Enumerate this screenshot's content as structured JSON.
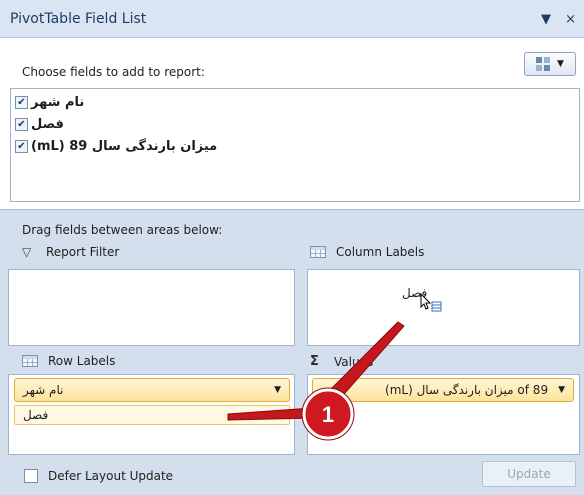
{
  "window": {
    "title": "PivotTable Field List",
    "controls": [
      "▼",
      "×"
    ]
  },
  "fields_section": {
    "instruction": "Choose fields to add to report:",
    "fields": [
      {
        "label": "نام شهر",
        "checked": true
      },
      {
        "label": "فصل",
        "checked": true
      },
      {
        "label": "میزان بارندگی سال 89 (mL)",
        "checked": true
      }
    ]
  },
  "areas_section": {
    "instruction": "Drag fields between areas below:",
    "report_filter": {
      "label": "Report Filter",
      "items": []
    },
    "column_labels": {
      "label": "Column Labels",
      "drag_text": "فصل"
    },
    "row_labels": {
      "label": "Row Labels",
      "items": [
        {
          "label": "نام شهر",
          "style": "dropdown"
        },
        {
          "label": "فصل",
          "style": "plain"
        }
      ]
    },
    "values": {
      "label": "Values",
      "items": [
        {
          "label": "of 89 میزان بارندگی سال (mL)",
          "style": "dropdown"
        }
      ]
    }
  },
  "footer": {
    "defer_label": "Defer Layout Update",
    "defer_checked": false,
    "update_label": "Update"
  },
  "annotation": {
    "number": "1",
    "color": "#c8161d"
  }
}
